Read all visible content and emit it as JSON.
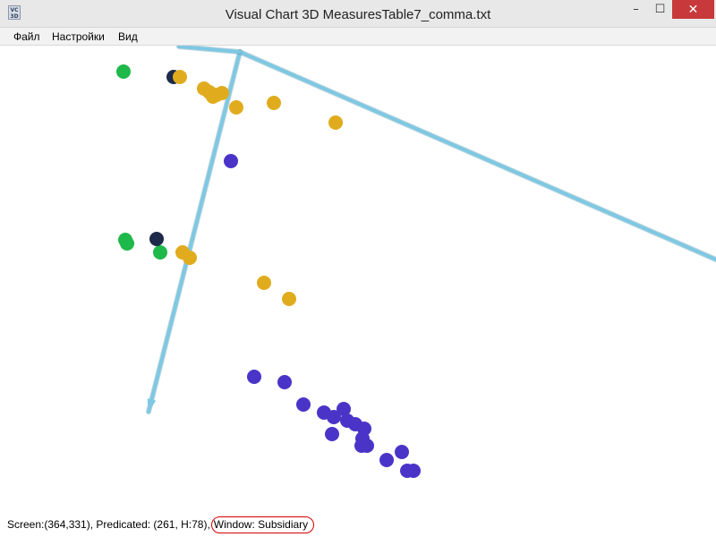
{
  "window": {
    "title": "Visual Chart 3D MeasuresTable7_comma.txt",
    "icon_label": "VC\n3D",
    "minimize_glyph": "–",
    "maximize_glyph": "☐",
    "close_glyph": "✕"
  },
  "menu": {
    "items": [
      "Файл",
      "Настройки",
      "Вид"
    ]
  },
  "status": {
    "text": "Screen:(364,331), Predicated: (261, H:78),",
    "window_text": "Window: Subsidiary"
  },
  "colors": {
    "axis": "#7ec8e3",
    "axis_dark": "#4a8ba0",
    "green": "#1fb84a",
    "navy": "#1e2a4a",
    "gold": "#e0ac1e",
    "violet": "#4a34c8"
  },
  "chart_data": {
    "type": "scatter",
    "title": "",
    "xlabel": "",
    "ylabel": "",
    "projection": "3d",
    "series": [
      {
        "color_key": "green",
        "points": [
          [
            138,
            80
          ],
          [
            140,
            268
          ],
          [
            142,
            272
          ],
          [
            179,
            282
          ]
        ]
      },
      {
        "color_key": "navy",
        "points": [
          [
            194,
            86
          ],
          [
            175,
            267
          ]
        ]
      },
      {
        "color_key": "gold",
        "points": [
          [
            201,
            86
          ],
          [
            228,
            99
          ],
          [
            234,
            103
          ],
          [
            238,
            108
          ],
          [
            242,
            106
          ],
          [
            248,
            104
          ],
          [
            264,
            120
          ],
          [
            306,
            115
          ],
          [
            375,
            137
          ],
          [
            204,
            282
          ],
          [
            212,
            288
          ],
          [
            295,
            316
          ],
          [
            323,
            334
          ]
        ]
      },
      {
        "color_key": "violet",
        "points": [
          [
            258,
            180
          ],
          [
            284,
            421
          ],
          [
            318,
            427
          ],
          [
            339,
            452
          ],
          [
            362,
            461
          ],
          [
            373,
            466
          ],
          [
            384,
            457
          ],
          [
            388,
            470
          ],
          [
            397,
            474
          ],
          [
            407,
            479
          ],
          [
            371,
            485
          ],
          [
            405,
            490
          ],
          [
            404,
            498
          ],
          [
            410,
            498
          ],
          [
            432,
            514
          ],
          [
            449,
            505
          ],
          [
            455,
            526
          ],
          [
            462,
            526
          ]
        ]
      }
    ],
    "axes": [
      {
        "from": [
          268,
          58
        ],
        "to": [
          166,
          460
        ],
        "arrow": true
      },
      {
        "from": [
          268,
          58
        ],
        "to": [
          800,
          290
        ],
        "arrow": false
      },
      {
        "from": [
          268,
          58
        ],
        "to": [
          200,
          52
        ],
        "arrow": false
      }
    ]
  }
}
